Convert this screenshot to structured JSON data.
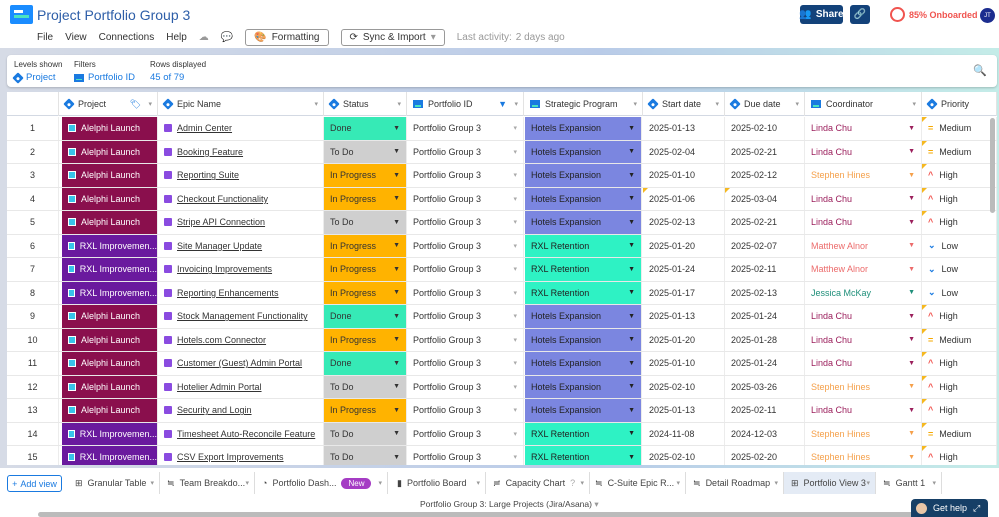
{
  "app": {
    "title": "Project Portfolio Group 3"
  },
  "menu": [
    "File",
    "View",
    "Connections",
    "Help"
  ],
  "toolbar": {
    "formatting": "Formatting",
    "sync": "Sync & Import",
    "last_activity_label": "Last activity:",
    "last_activity_value": "2 days ago"
  },
  "header": {
    "share": "Share",
    "onboarded": "85% Onboarded",
    "avatar": "JT"
  },
  "filters": {
    "levels_label": "Levels shown",
    "levels_value": "Project",
    "filters_label": "Filters",
    "filters_value": "Portfolio ID",
    "rows_label": "Rows displayed",
    "rows_value": "45 of 79"
  },
  "columns": [
    "Project",
    "Epic Name",
    "Status",
    "Portfolio ID",
    "Strategic Program",
    "Start date",
    "Due date",
    "Coordinator",
    "Priority"
  ],
  "colors": {
    "Alelphi Launch": "#8a0f4d",
    "RXL Improvemen...": "#6a1a9e",
    "Done": "#36eab6",
    "To Do": "#cfcfcf",
    "In Progress": "#ffb300",
    "Hotels Expansion": "#7b86e0",
    "RXL Retention": "#2ef2c4",
    "Linda Chu": "#9b1f5c",
    "Stephen Hines": "#f5a04a",
    "Matthew Alnor": "#ec6b6b",
    "Jessica McKay": "#1f8f7a",
    "Medium": "#f5a800",
    "High": "#f0544f",
    "Low": "#1a7ae0"
  },
  "rows": [
    {
      "n": "1",
      "project": "Alelphi Launch",
      "epic": "Admin Center",
      "status": "Done",
      "portfolio": "Portfolio Group 3",
      "program": "Hotels Expansion",
      "start": "2025-01-13",
      "due": "2025-02-10",
      "coord": "Linda Chu",
      "priority": "Medium"
    },
    {
      "n": "2",
      "project": "Alelphi Launch",
      "epic": "Booking Feature",
      "status": "To Do",
      "portfolio": "Portfolio Group 3",
      "program": "Hotels Expansion",
      "start": "2025-02-04",
      "due": "2025-02-21",
      "coord": "Linda Chu",
      "priority": "Medium"
    },
    {
      "n": "3",
      "project": "Alelphi Launch",
      "epic": "Reporting Suite",
      "status": "In Progress",
      "portfolio": "Portfolio Group 3",
      "program": "Hotels Expansion",
      "start": "2025-01-10",
      "due": "2025-02-12",
      "coord": "Stephen Hines",
      "priority": "High"
    },
    {
      "n": "4",
      "project": "Alelphi Launch",
      "epic": "Checkout Functionality",
      "status": "In Progress",
      "portfolio": "Portfolio Group 3",
      "program": "Hotels Expansion",
      "start": "2025-01-06",
      "due": "2025-03-04",
      "coord": "Linda Chu",
      "priority": "High"
    },
    {
      "n": "5",
      "project": "Alelphi Launch",
      "epic": "Stripe API Connection",
      "status": "To Do",
      "portfolio": "Portfolio Group 3",
      "program": "Hotels Expansion",
      "start": "2025-02-13",
      "due": "2025-02-21",
      "coord": "Linda Chu",
      "priority": "High"
    },
    {
      "n": "6",
      "project": "RXL Improvemen...",
      "epic": "Site Manager Update",
      "status": "In Progress",
      "portfolio": "Portfolio Group 3",
      "program": "RXL Retention",
      "start": "2025-01-20",
      "due": "2025-02-07",
      "coord": "Matthew Alnor",
      "priority": "Low"
    },
    {
      "n": "7",
      "project": "RXL Improvemen...",
      "epic": "Invoicing Improvements",
      "status": "In Progress",
      "portfolio": "Portfolio Group 3",
      "program": "RXL Retention",
      "start": "2025-01-24",
      "due": "2025-02-11",
      "coord": "Matthew Alnor",
      "priority": "Low"
    },
    {
      "n": "8",
      "project": "RXL Improvemen...",
      "epic": "Reporting Enhancements",
      "status": "In Progress",
      "portfolio": "Portfolio Group 3",
      "program": "RXL Retention",
      "start": "2025-01-17",
      "due": "2025-02-13",
      "coord": "Jessica McKay",
      "priority": "Low"
    },
    {
      "n": "9",
      "project": "Alelphi Launch",
      "epic": "Stock Management Functionality",
      "status": "Done",
      "portfolio": "Portfolio Group 3",
      "program": "Hotels Expansion",
      "start": "2025-01-13",
      "due": "2025-01-24",
      "coord": "Linda Chu",
      "priority": "High"
    },
    {
      "n": "10",
      "project": "Alelphi Launch",
      "epic": "Hotels.com Connector",
      "status": "In Progress",
      "portfolio": "Portfolio Group 3",
      "program": "Hotels Expansion",
      "start": "2025-01-20",
      "due": "2025-01-28",
      "coord": "Linda Chu",
      "priority": "Medium"
    },
    {
      "n": "11",
      "project": "Alelphi Launch",
      "epic": "Customer (Guest) Admin Portal",
      "status": "Done",
      "portfolio": "Portfolio Group 3",
      "program": "Hotels Expansion",
      "start": "2025-01-10",
      "due": "2025-01-24",
      "coord": "Linda Chu",
      "priority": "High"
    },
    {
      "n": "12",
      "project": "Alelphi Launch",
      "epic": "Hotelier Admin Portal",
      "status": "To Do",
      "portfolio": "Portfolio Group 3",
      "program": "Hotels Expansion",
      "start": "2025-02-10",
      "due": "2025-03-26",
      "coord": "Stephen Hines",
      "priority": "High"
    },
    {
      "n": "13",
      "project": "Alelphi Launch",
      "epic": "Security and Login",
      "status": "In Progress",
      "portfolio": "Portfolio Group 3",
      "program": "Hotels Expansion",
      "start": "2025-01-13",
      "due": "2025-02-11",
      "coord": "Linda Chu",
      "priority": "High"
    },
    {
      "n": "14",
      "project": "RXL Improvemen...",
      "epic": "Timesheet Auto-Reconcile Feature",
      "status": "To Do",
      "portfolio": "Portfolio Group 3",
      "program": "RXL Retention",
      "start": "2024-11-08",
      "due": "2024-12-03",
      "coord": "Stephen Hines",
      "priority": "Medium"
    },
    {
      "n": "15",
      "project": "RXL Improvemen...",
      "epic": "CSV Export Improvements",
      "status": "To Do",
      "portfolio": "Portfolio Group 3",
      "program": "RXL Retention",
      "start": "2025-02-10",
      "due": "2025-02-20",
      "coord": "Stephen Hines",
      "priority": "High"
    }
  ],
  "views": {
    "add_view": "Add view",
    "tabs": [
      "Granular Table",
      "Team Breakdo...",
      "Portfolio Dash...",
      "Portfolio Board",
      "Capacity Chart",
      "C-Suite Epic R...",
      "Detail Roadmap",
      "Portfolio View 3",
      "Gantt 1"
    ],
    "new_badge": "New",
    "sheet": "Portfolio Group 3: Large Projects (Jira/Asana)",
    "help": "Get help"
  }
}
